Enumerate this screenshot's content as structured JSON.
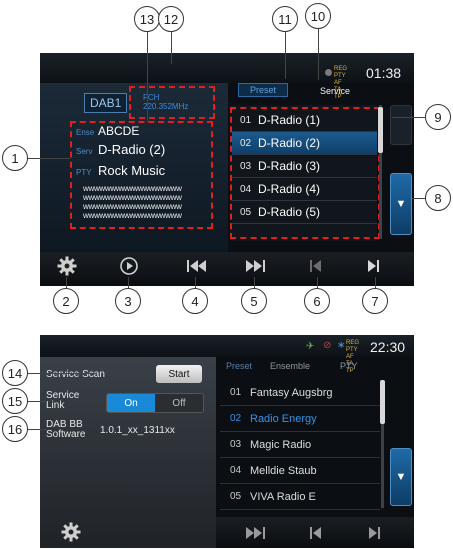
{
  "callouts": [
    "1",
    "2",
    "3",
    "4",
    "5",
    "6",
    "7",
    "8",
    "9",
    "10",
    "11",
    "12",
    "13",
    "14",
    "15",
    "16"
  ],
  "screen1": {
    "clock": "01:38",
    "reg_pty": [
      "REG",
      "PTY",
      "AF",
      "TA",
      "TP"
    ],
    "tabs": {
      "preset": "Preset",
      "service": "Service"
    },
    "band": "DAB1",
    "fch_label": "FCH",
    "frequency": "220.352MHz",
    "ensemble_tag": "Ense",
    "ensemble": "ABCDE",
    "service_tag": "Serv",
    "service": "D-Radio (2)",
    "pty_tag": "PTY",
    "pty": "Rock Music",
    "text_lines": [
      "wwwwwwwwwwwwwwwwww",
      "wwwwwwwwwwwwwwwwww",
      "wwwwwwwwwwwwwwwwww",
      "wwwwwwwwwwwwwwwwww"
    ],
    "presets": [
      {
        "num": "01",
        "name": "D-Radio (1)"
      },
      {
        "num": "02",
        "name": "D-Radio (2)"
      },
      {
        "num": "03",
        "name": "D-Radio (3)"
      },
      {
        "num": "04",
        "name": "D-Radio (4)"
      },
      {
        "num": "05",
        "name": "D-Radio (5)"
      }
    ],
    "selected_preset": 1,
    "down_arrow": "▼",
    "controls": [
      "gear-icon",
      "play-scan-icon",
      "skip-back-icon",
      "skip-forward-icon",
      "prev-icon",
      "next-icon"
    ]
  },
  "screen2": {
    "clock": "22:30",
    "reg_pty": [
      "REG",
      "PTY",
      "AF",
      "TA",
      "TP"
    ],
    "service_scan": "Service Scan",
    "start": "Start",
    "service_link": "Service\nLink",
    "on": "On",
    "off": "Off",
    "software_label": "DAB BB\nSoftware",
    "software_version": "1.0.1_xx_1311xx",
    "tabs": {
      "preset": "Preset",
      "ensemble": "Ensemble",
      "pty": "PTY"
    },
    "stations": [
      {
        "num": "01",
        "name": "Fantasy Augsbrg"
      },
      {
        "num": "02",
        "name": "Radio Energy"
      },
      {
        "num": "03",
        "name": "Magic Radio"
      },
      {
        "num": "04",
        "name": "Melldie Staub"
      },
      {
        "num": "05",
        "name": "VIVA Radio E"
      }
    ],
    "highlighted_station": 1,
    "down_arrow": "▼"
  },
  "colors": {
    "accent": "#1c5a8e",
    "highlight": "#3b8fe0",
    "annotation": "#e02020"
  }
}
